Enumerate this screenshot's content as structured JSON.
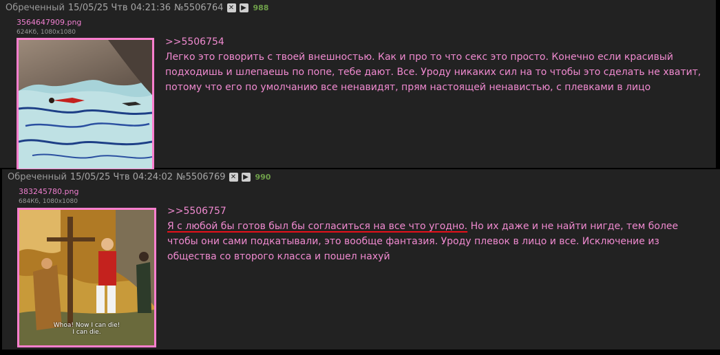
{
  "posts": [
    {
      "name": "Обреченный",
      "date": "15/05/25 Чтв 04:21:36",
      "num": "№5506764",
      "count": "988",
      "file": {
        "name": "3564647909.png",
        "meta": "624Кб, 1080x1080"
      },
      "reply": ">>5506754",
      "text": "Легко это говорить с твоей внешностью. Как и про то что секс это просто. Конечно если красивый подходишь и шлепаешь по попе, тебе дают. Все. Уроду никаких сил на то чтобы это сделать не хватит, потому что его по умолчанию все ненавидят, прям настоящей ненавистью, с плевками в лицо"
    },
    {
      "name": "Обреченный",
      "date": "15/05/25 Чтв 04:24:02",
      "num": "№5506769",
      "count": "990",
      "file": {
        "name": "383245780.png",
        "meta": "684Кб, 1080x1080",
        "caption_line1": "Whoa! Now I can die!",
        "caption_line2": "I can die."
      },
      "reply": ">>5506757",
      "text_underlined": "Я с любой бы готов был бы согласиться на все что угодно.",
      "text_rest": " Но их даже и не найти нигде, тем более чтобы они сами подкатывали, это вообще фантазия. Уроду плевок в лицо и все. Исключение из общества со второго класса и пошел нахуй"
    }
  ],
  "icons": {
    "close": "close-icon",
    "play": "play-icon"
  },
  "colors": {
    "post_bg": "#222222",
    "text": "#f08ad0",
    "border": "#ff7fcf",
    "count": "#6fa04a"
  }
}
